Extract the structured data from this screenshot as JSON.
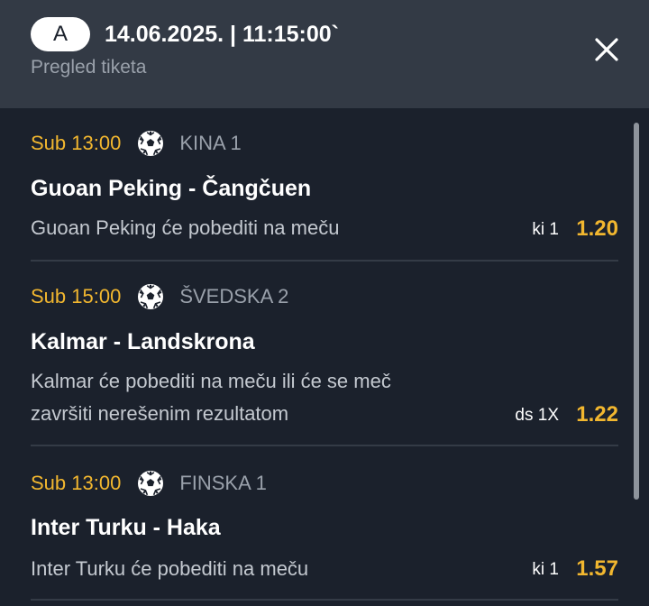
{
  "header": {
    "ticket_label": "A",
    "datetime": "14.06.2025. | 11:15:00`",
    "subtitle": "Pregled tiketa"
  },
  "icons": {
    "close": "close-icon",
    "sport": "soccer-ball-icon"
  },
  "colors": {
    "header_bg": "#333a45",
    "list_bg": "#1b212c",
    "accent": "#f2b72f",
    "muted_text": "#9aa1ab"
  },
  "bets": [
    {
      "time": "Sub 13:00",
      "league": "KINA 1",
      "match": "Guoan Peking - Čangčuen",
      "pick_line1": "Guoan Peking će pobediti na meču",
      "pick_line2": "",
      "code": "ki 1",
      "odds": "1.20"
    },
    {
      "time": "Sub 15:00",
      "league": "ŠVEDSKA 2",
      "match": "Kalmar - Landskrona",
      "pick_line1": "Kalmar će pobediti na meču ili će se meč",
      "pick_line2": "završiti nerešenim rezultatom",
      "code": "ds 1X",
      "odds": "1.22"
    },
    {
      "time": "Sub 13:00",
      "league": "FINSKA 1",
      "match": "Inter Turku - Haka",
      "pick_line1": "Inter Turku će pobediti na meču",
      "pick_line2": "",
      "code": "ki 1",
      "odds": "1.57"
    }
  ]
}
